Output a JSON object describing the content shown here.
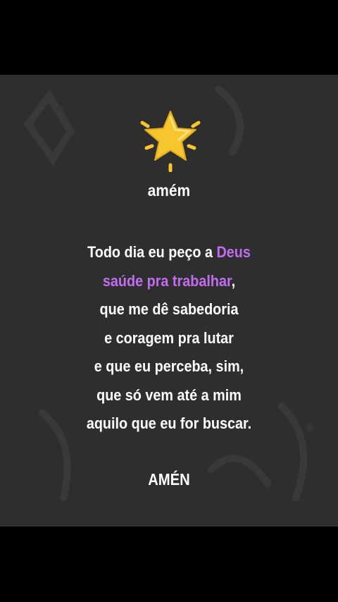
{
  "post": {
    "icon": "star-icon",
    "heading": "amém",
    "poem": {
      "line1_pre": "Todo dia eu peço a ",
      "line1_highlight": "Deus",
      "line2_highlight": "saúde pra trabalhar",
      "line2_post": ",",
      "line3": "que me dê sabedoria",
      "line4": "e coragem pra lutar",
      "line5": "e que eu perceba, sim,",
      "line6": "que só vem até a mim",
      "line7": "aquilo que eu for buscar."
    },
    "closing": "AMÉN"
  },
  "colors": {
    "background": "#2f2e2f",
    "letterbox": "#000000",
    "text": "#ffffff",
    "highlight": "#c26cf0",
    "star": "#f7c62e"
  }
}
